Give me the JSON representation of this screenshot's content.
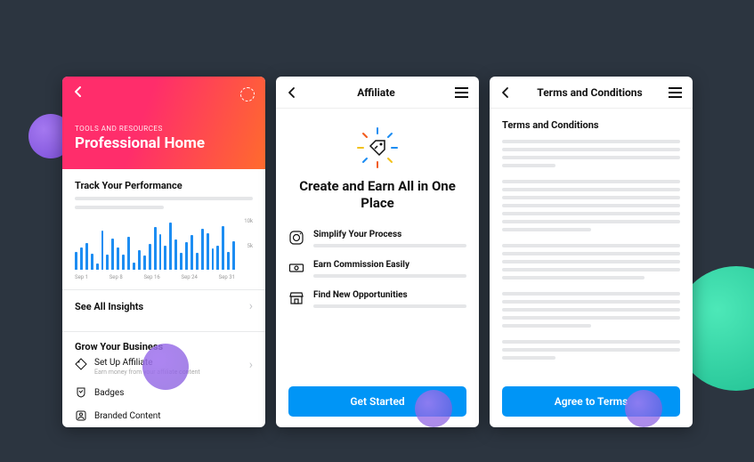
{
  "screen1": {
    "eyebrow": "TOOLS AND RESOURCES",
    "title": "Professional Home",
    "track_title": "Track Your Performance",
    "see_all": "See All Insights",
    "grow_title": "Grow Your Business",
    "items": [
      {
        "label": "Set Up Affiliate",
        "sub": "Earn money from your affiliate content"
      },
      {
        "label": "Badges"
      },
      {
        "label": "Branded Content"
      }
    ]
  },
  "chart_data": {
    "type": "bar",
    "categories": [
      "Sep 1",
      "",
      "",
      "",
      "",
      "",
      "",
      "Sep 8",
      "",
      "",
      "",
      "",
      "",
      "",
      "",
      "Sep 16",
      "",
      "",
      "",
      "",
      "",
      "",
      "",
      "Sep 24",
      "",
      "",
      "",
      "",
      "",
      "",
      "Sep 31"
    ],
    "values": [
      3500,
      4500,
      5300,
      3200,
      1200,
      7800,
      3000,
      6200,
      4400,
      3000,
      6600,
      1500,
      3900,
      2800,
      5100,
      8500,
      7200,
      4800,
      9400,
      6000,
      3400,
      5500,
      7000,
      3400,
      8200,
      7400,
      4200,
      4900,
      8800,
      3600,
      5800
    ],
    "xlabel": "",
    "ylabel": "",
    "yticks": [
      "10k",
      "5k"
    ],
    "ylim": [
      0,
      10000
    ],
    "xticks_visible": [
      "Sep 1",
      "Sep 8",
      "Sep 16",
      "Sep 24",
      "Sep 31"
    ]
  },
  "screen2": {
    "topbar_title": "Affiliate",
    "title": "Create and Earn All in One Place",
    "features": [
      {
        "label": "Simplify Your Process"
      },
      {
        "label": "Earn Commission Easily"
      },
      {
        "label": "Find New Opportunities"
      }
    ],
    "cta": "Get Started"
  },
  "screen3": {
    "topbar_title": "Terms and Conditions",
    "heading": "Terms and Conditions",
    "cta": "Agree to Terms"
  },
  "colors": {
    "accent": "#0095f6",
    "bar": "#1d8df2",
    "header_gradient": [
      "#ff2d6b",
      "#ff6b2d"
    ]
  }
}
